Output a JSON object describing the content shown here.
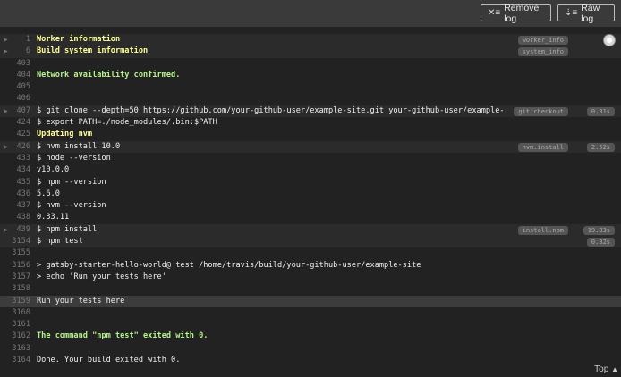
{
  "toolbar": {
    "remove_log": "Remove log",
    "raw_log": "Raw log",
    "top": "Top",
    "top_icon": "▲"
  },
  "colors": {
    "header_bg": "#3a3a3a",
    "log_bg": "#222222",
    "yellow": "#ffff91",
    "green": "#b4f58a"
  },
  "lines": [
    {
      "n": "1",
      "text": "Worker information",
      "style": "yellow",
      "fold": true,
      "label": "worker_info"
    },
    {
      "n": "6",
      "text": "Build system information",
      "style": "yellow",
      "fold": true,
      "label": "system_info"
    },
    {
      "n": "403",
      "text": ""
    },
    {
      "n": "404",
      "text": "Network availability confirmed.",
      "style": "green"
    },
    {
      "n": "405",
      "text": ""
    },
    {
      "n": "406",
      "text": ""
    },
    {
      "n": "407",
      "text": "$ git clone --depth=50 https://github.com/your-github-user/example-site.git your-github-user/example-",
      "fold": true,
      "label": "git.checkout",
      "time": "0.31s"
    },
    {
      "n": "424",
      "text": "$ export PATH=./node_modules/.bin:$PATH"
    },
    {
      "n": "425",
      "text": "Updating nvm",
      "style": "yellow"
    },
    {
      "n": "426",
      "text": "$ nvm install 10.0",
      "fold": true,
      "label": "nvm.install",
      "time": "2.52s"
    },
    {
      "n": "433",
      "text": "$ node --version"
    },
    {
      "n": "434",
      "text": "v10.0.0"
    },
    {
      "n": "435",
      "text": "$ npm --version"
    },
    {
      "n": "436",
      "text": "5.6.0"
    },
    {
      "n": "437",
      "text": "$ nvm --version"
    },
    {
      "n": "438",
      "text": "0.33.11"
    },
    {
      "n": "439",
      "text": "$ npm install",
      "fold": true,
      "label": "install.npm",
      "time": "19.83s"
    },
    {
      "n": "3154",
      "text": "$ npm test",
      "time": "0.32s"
    },
    {
      "n": "3155",
      "text": ""
    },
    {
      "n": "3156",
      "text": "> gatsby-starter-hello-world@ test /home/travis/build/your-github-user/example-site"
    },
    {
      "n": "3157",
      "text": "> echo 'Run your tests here'"
    },
    {
      "n": "3158",
      "text": ""
    },
    {
      "n": "3159",
      "text": "Run your tests here",
      "highlight": true
    },
    {
      "n": "3160",
      "text": ""
    },
    {
      "n": "3161",
      "text": ""
    },
    {
      "n": "3162",
      "text": "The command \"npm test\" exited with 0.",
      "style": "green"
    },
    {
      "n": "3163",
      "text": ""
    },
    {
      "n": "3164",
      "text": "Done. Your build exited with 0."
    }
  ]
}
